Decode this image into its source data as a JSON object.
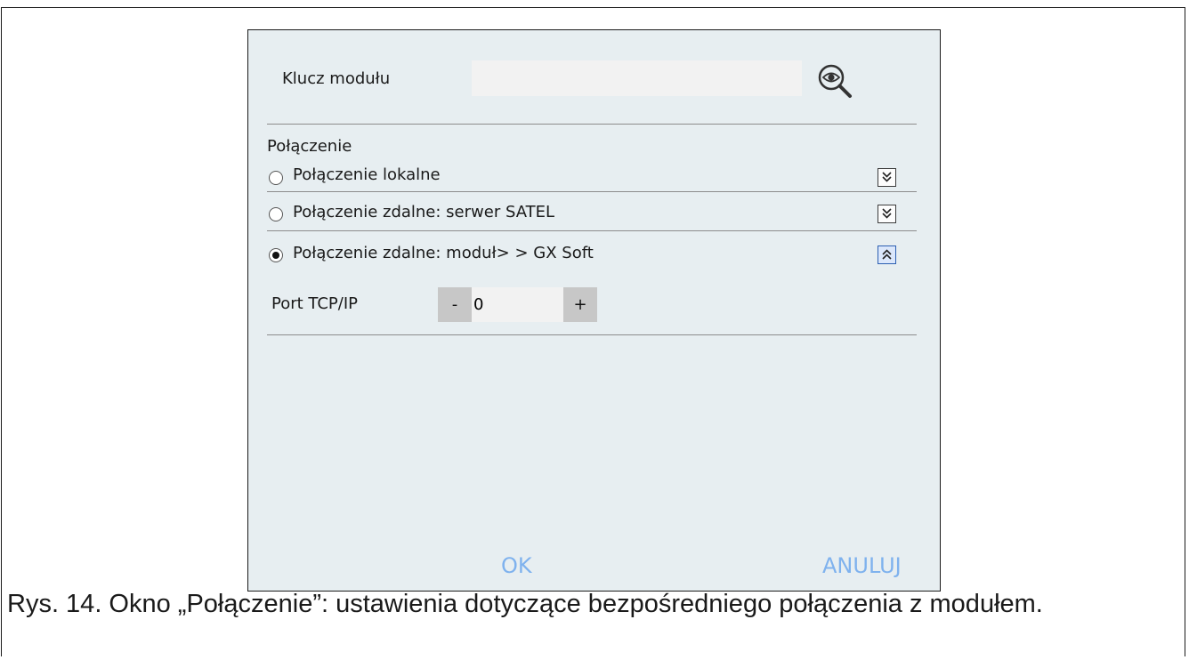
{
  "dialog": {
    "key_label": "Klucz modułu",
    "key_value": "",
    "section_label": "Połączenie",
    "options": [
      {
        "label": "Połączenie lokalne",
        "selected": false,
        "expanded": false
      },
      {
        "label": "Połączenie zdalne: serwer SATEL",
        "selected": false,
        "expanded": false
      },
      {
        "label": "Połączenie zdalne: moduł> > GX Soft",
        "selected": true,
        "expanded": true
      }
    ],
    "port_label": "Port TCP/IP",
    "port_value": "0",
    "minus_label": "-",
    "plus_label": "+",
    "ok_label": "OK",
    "cancel_label": "ANULUJ"
  },
  "caption": "Rys. 14. Okno „Połączenie”: ustawienia dotyczące bezpośredniego połączenia z modułem.",
  "colors": {
    "dialog_bg": "#e7eef1",
    "button_text": "#7fb2ee",
    "active_toggle": "#2c5fb2"
  },
  "icons": [
    "eye-magnifier-icon",
    "chevron-double-down-icon",
    "chevron-double-up-icon"
  ]
}
